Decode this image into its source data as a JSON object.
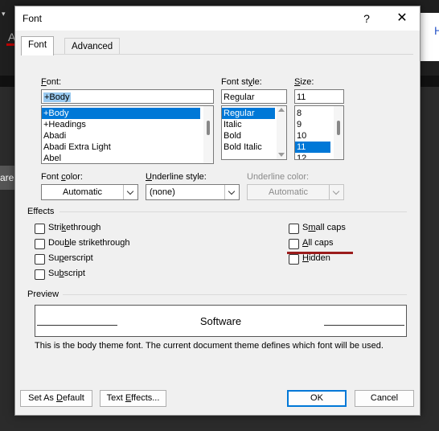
{
  "background": {
    "fragment_text": "are",
    "glyph_a": "A",
    "glyph_right": "H"
  },
  "dialog": {
    "title": "Font",
    "help": "?",
    "close": "✕"
  },
  "tabs": [
    {
      "label": "Font",
      "active": true
    },
    {
      "label": "Advanced",
      "active": false
    }
  ],
  "font_section": {
    "font_label_key": "F",
    "font_label_rest": "ont:",
    "font_value": "+Body",
    "font_list": [
      "+Body",
      "+Headings",
      "Abadi",
      "Abadi Extra Light",
      "Abel"
    ],
    "font_selected_index": 0,
    "style_label": "Font st",
    "style_label_key": "y",
    "style_label_rest": "le:",
    "style_value": "Regular",
    "style_list": [
      "Regular",
      "Italic",
      "Bold",
      "Bold Italic"
    ],
    "style_selected_index": 0,
    "size_label_key": "S",
    "size_label_rest": "ize:",
    "size_value": "11",
    "size_list": [
      "8",
      "9",
      "10",
      "11",
      "12"
    ],
    "size_selected_index": 3
  },
  "color_row": {
    "font_color_label": "Font ",
    "font_color_key": "c",
    "font_color_rest": "olor:",
    "font_color_value": "Automatic",
    "underline_style_label_key": "U",
    "underline_style_label_rest": "nderline style:",
    "underline_style_value": "(none)",
    "underline_color_label": "Underline color:",
    "underline_color_value": "Automatic"
  },
  "effects": {
    "heading": "Effects",
    "left": [
      {
        "pre": "Stri",
        "key": "k",
        "post": "ethrough",
        "checked": false
      },
      {
        "pre": "Dou",
        "key": "b",
        "post": "le strikethrough",
        "checked": false
      },
      {
        "pre": "Su",
        "key": "p",
        "post": "erscript",
        "checked": false
      },
      {
        "pre": "Su",
        "key": "b",
        "post": "script",
        "checked": false
      }
    ],
    "right": [
      {
        "pre": "S",
        "key": "m",
        "post": "all caps",
        "checked": false
      },
      {
        "pre": "",
        "key": "A",
        "post": "ll caps",
        "checked": false
      },
      {
        "pre": "",
        "key": "H",
        "post": "idden",
        "checked": false
      }
    ]
  },
  "preview": {
    "heading": "Preview",
    "sample": "Software",
    "description": "This is the body theme font. The current document theme defines which font will be used."
  },
  "buttons": {
    "set_default_pre": "Set As ",
    "set_default_key": "D",
    "set_default_post": "efault",
    "text_effects_pre": "Text ",
    "text_effects_key": "E",
    "text_effects_post": "ffects...",
    "ok": "OK",
    "cancel": "Cancel"
  }
}
